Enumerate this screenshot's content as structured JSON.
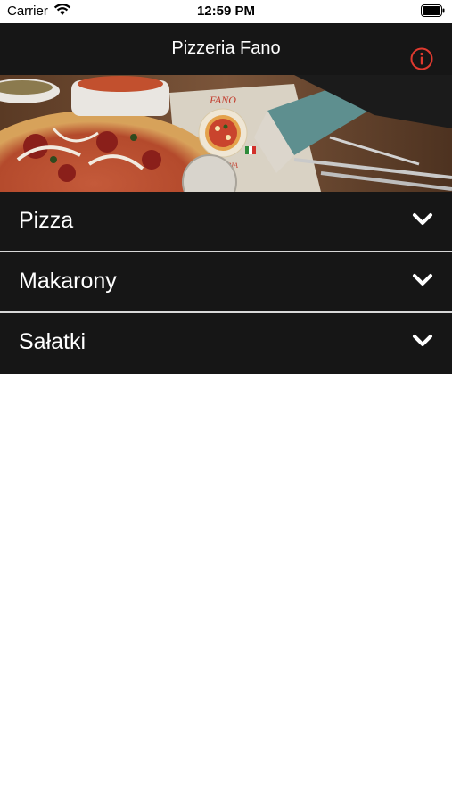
{
  "status_bar": {
    "carrier": "Carrier",
    "time": "12:59 PM"
  },
  "nav": {
    "title": "Pizzeria Fano",
    "info_icon": "info-icon",
    "accent": "#e03a2f"
  },
  "banner": {
    "logo_text_top": "FANO",
    "logo_text_bottom": "PIZZERIA"
  },
  "menu": {
    "items": [
      {
        "label": "Pizza"
      },
      {
        "label": "Makarony"
      },
      {
        "label": "Sałatki"
      }
    ],
    "chevron_icon": "chevron-down-icon"
  },
  "colors": {
    "bar_bg": "#161616",
    "divider": "#d8d8d8",
    "background": "#ffffff"
  }
}
